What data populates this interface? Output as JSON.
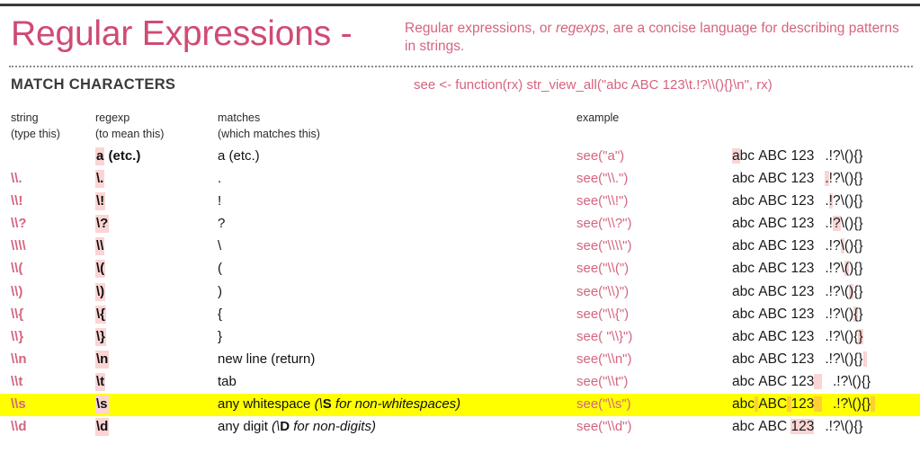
{
  "header": {
    "title": "Regular Expressions -",
    "subtitle_pre": "Regular expressions, or ",
    "subtitle_em": "regexps",
    "subtitle_post": ", are a concise language for describing patterns in strings.",
    "title_color": "#cf4b74",
    "accent_color": "#d4647f",
    "highlight_pink": "#fbd4d4",
    "highlight_yellow": "#ffff00"
  },
  "section": {
    "title": "MATCH CHARACTERS",
    "code": "see <- function(rx) str_view_all(\"abc ABC 123\\t.!?\\\\(){}\\n\", rx)"
  },
  "columns": {
    "string": {
      "label": "string",
      "sub": "(type this)"
    },
    "regexp": {
      "label": "regexp",
      "sub": "(to mean this)"
    },
    "matches": {
      "label": "matches",
      "sub": "(which matches this)"
    },
    "example": {
      "label": "example",
      "sub": ""
    }
  },
  "output_template": {
    "prefix": "abc ABC 123",
    "suffix": ".!?\\(){}"
  },
  "rows": [
    {
      "string": "",
      "regexp_hl": "a",
      "regexp_rest": " (etc.)",
      "matches": "a (etc.)",
      "matches_note": "",
      "example": "see(\"a\")",
      "out_pre": [
        {
          "t": "a",
          "h": true
        },
        {
          "t": "bc ABC 123",
          "h": false
        }
      ],
      "out_suf": [
        {
          "t": ".!?\\(){}",
          "h": false
        }
      ],
      "highlight": false
    },
    {
      "string": "\\\\.",
      "regexp_hl": "\\.",
      "regexp_rest": "",
      "matches": ".",
      "matches_note": "",
      "example": "see(\"\\\\.\")",
      "out_pre": [
        {
          "t": "abc ABC 123",
          "h": false
        }
      ],
      "out_suf": [
        {
          "t": ".",
          "h": true
        },
        {
          "t": "!?\\(){}",
          "h": false
        }
      ],
      "highlight": false
    },
    {
      "string": "\\\\!",
      "regexp_hl": "\\!",
      "regexp_rest": "",
      "matches": "!",
      "matches_note": "",
      "example": "see(\"\\\\!\")",
      "out_pre": [
        {
          "t": "abc ABC 123",
          "h": false
        }
      ],
      "out_suf": [
        {
          "t": ".",
          "h": false
        },
        {
          "t": "!",
          "h": true
        },
        {
          "t": "?\\(){}",
          "h": false
        }
      ],
      "highlight": false
    },
    {
      "string": "\\\\?",
      "regexp_hl": "\\?",
      "regexp_rest": "",
      "matches": "?",
      "matches_note": "",
      "example": "see(\"\\\\?\")",
      "out_pre": [
        {
          "t": "abc ABC 123",
          "h": false
        }
      ],
      "out_suf": [
        {
          "t": ".!",
          "h": false
        },
        {
          "t": "?",
          "h": true
        },
        {
          "t": "\\(){}",
          "h": false
        }
      ],
      "highlight": false
    },
    {
      "string": "\\\\\\\\",
      "regexp_hl": "\\\\",
      "regexp_rest": "",
      "matches": "\\",
      "matches_note": "",
      "example": "see(\"\\\\\\\\\")",
      "out_pre": [
        {
          "t": "abc ABC 123",
          "h": false
        }
      ],
      "out_suf": [
        {
          "t": ".!?",
          "h": false
        },
        {
          "t": "\\",
          "h": true
        },
        {
          "t": "(){}",
          "h": false
        }
      ],
      "highlight": false
    },
    {
      "string": "\\\\(",
      "regexp_hl": "\\(",
      "regexp_rest": "",
      "matches": "(",
      "matches_note": "",
      "example": "see(\"\\\\(\")",
      "out_pre": [
        {
          "t": "abc ABC 123",
          "h": false
        }
      ],
      "out_suf": [
        {
          "t": ".!?\\",
          "h": false
        },
        {
          "t": "(",
          "h": true
        },
        {
          "t": "){}",
          "h": false
        }
      ],
      "highlight": false
    },
    {
      "string": "\\\\)",
      "regexp_hl": "\\)",
      "regexp_rest": "",
      "matches": ")",
      "matches_note": "",
      "example": "see(\"\\\\)\")",
      "out_pre": [
        {
          "t": "abc ABC 123",
          "h": false
        }
      ],
      "out_suf": [
        {
          "t": ".!?\\(",
          "h": false
        },
        {
          "t": ")",
          "h": true
        },
        {
          "t": "{}",
          "h": false
        }
      ],
      "highlight": false
    },
    {
      "string": "\\\\{",
      "regexp_hl": "\\{",
      "regexp_rest": "",
      "matches": "{",
      "matches_note": "",
      "example": "see(\"\\\\{\")",
      "out_pre": [
        {
          "t": "abc ABC 123",
          "h": false
        }
      ],
      "out_suf": [
        {
          "t": ".!?\\()",
          "h": false
        },
        {
          "t": "{",
          "h": true
        },
        {
          "t": "}",
          "h": false
        }
      ],
      "highlight": false
    },
    {
      "string": "\\\\}",
      "regexp_hl": "\\}",
      "regexp_rest": "",
      "matches": "}",
      "matches_note": "",
      "example": "see( \"\\\\}\")",
      "out_pre": [
        {
          "t": "abc ABC 123",
          "h": false
        }
      ],
      "out_suf": [
        {
          "t": ".!?\\(){",
          "h": false
        },
        {
          "t": "}",
          "h": true
        }
      ],
      "highlight": false
    },
    {
      "string": "\\\\n",
      "regexp_hl": "\\n",
      "regexp_rest": "",
      "matches": "new line (return)",
      "matches_note": "",
      "example": "see(\"\\\\n\")",
      "out_pre": [
        {
          "t": "abc ABC 123",
          "h": false
        }
      ],
      "out_suf": [
        {
          "t": ".!?\\(){}",
          "h": false
        },
        {
          "t": " ",
          "h": true
        }
      ],
      "highlight": false
    },
    {
      "string": "\\\\t",
      "regexp_hl": "\\t",
      "regexp_rest": "",
      "matches": "tab",
      "matches_note": "",
      "example": "see(\"\\\\t\")",
      "out_pre": [
        {
          "t": "abc ABC 123",
          "h": false
        },
        {
          "t": "  ",
          "h": true
        }
      ],
      "out_suf": [
        {
          "t": ".!?\\(){}",
          "h": false
        }
      ],
      "highlight": false
    },
    {
      "string": "\\\\s",
      "regexp_hl": "\\s",
      "regexp_rest": "",
      "matches": "any whitespace ",
      "matches_note": "(\\S for non-whitespaces)",
      "matches_note_bold": "S",
      "example": "see(\"\\\\s\")",
      "out_pre": [
        {
          "t": "abc",
          "h": false
        },
        {
          "t": " ",
          "h": true
        },
        {
          "t": "ABC",
          "h": false
        },
        {
          "t": " ",
          "h": true
        },
        {
          "t": "123",
          "h": false
        },
        {
          "t": "  ",
          "h": true
        }
      ],
      "out_suf": [
        {
          "t": ".!?\\(){}",
          "h": false
        },
        {
          "t": " ",
          "h": true
        }
      ],
      "highlight": true
    },
    {
      "string": "\\\\d",
      "regexp_hl": "\\d",
      "regexp_rest": "",
      "matches": "any digit ",
      "matches_note": "(\\D for non-digits)",
      "matches_note_bold": "D",
      "example": "see(\"\\\\d\")",
      "out_pre": [
        {
          "t": "abc ABC ",
          "h": false
        },
        {
          "t": "123",
          "h": true
        }
      ],
      "out_suf": [
        {
          "t": ".!?\\(){}",
          "h": false
        }
      ],
      "highlight": false
    }
  ]
}
